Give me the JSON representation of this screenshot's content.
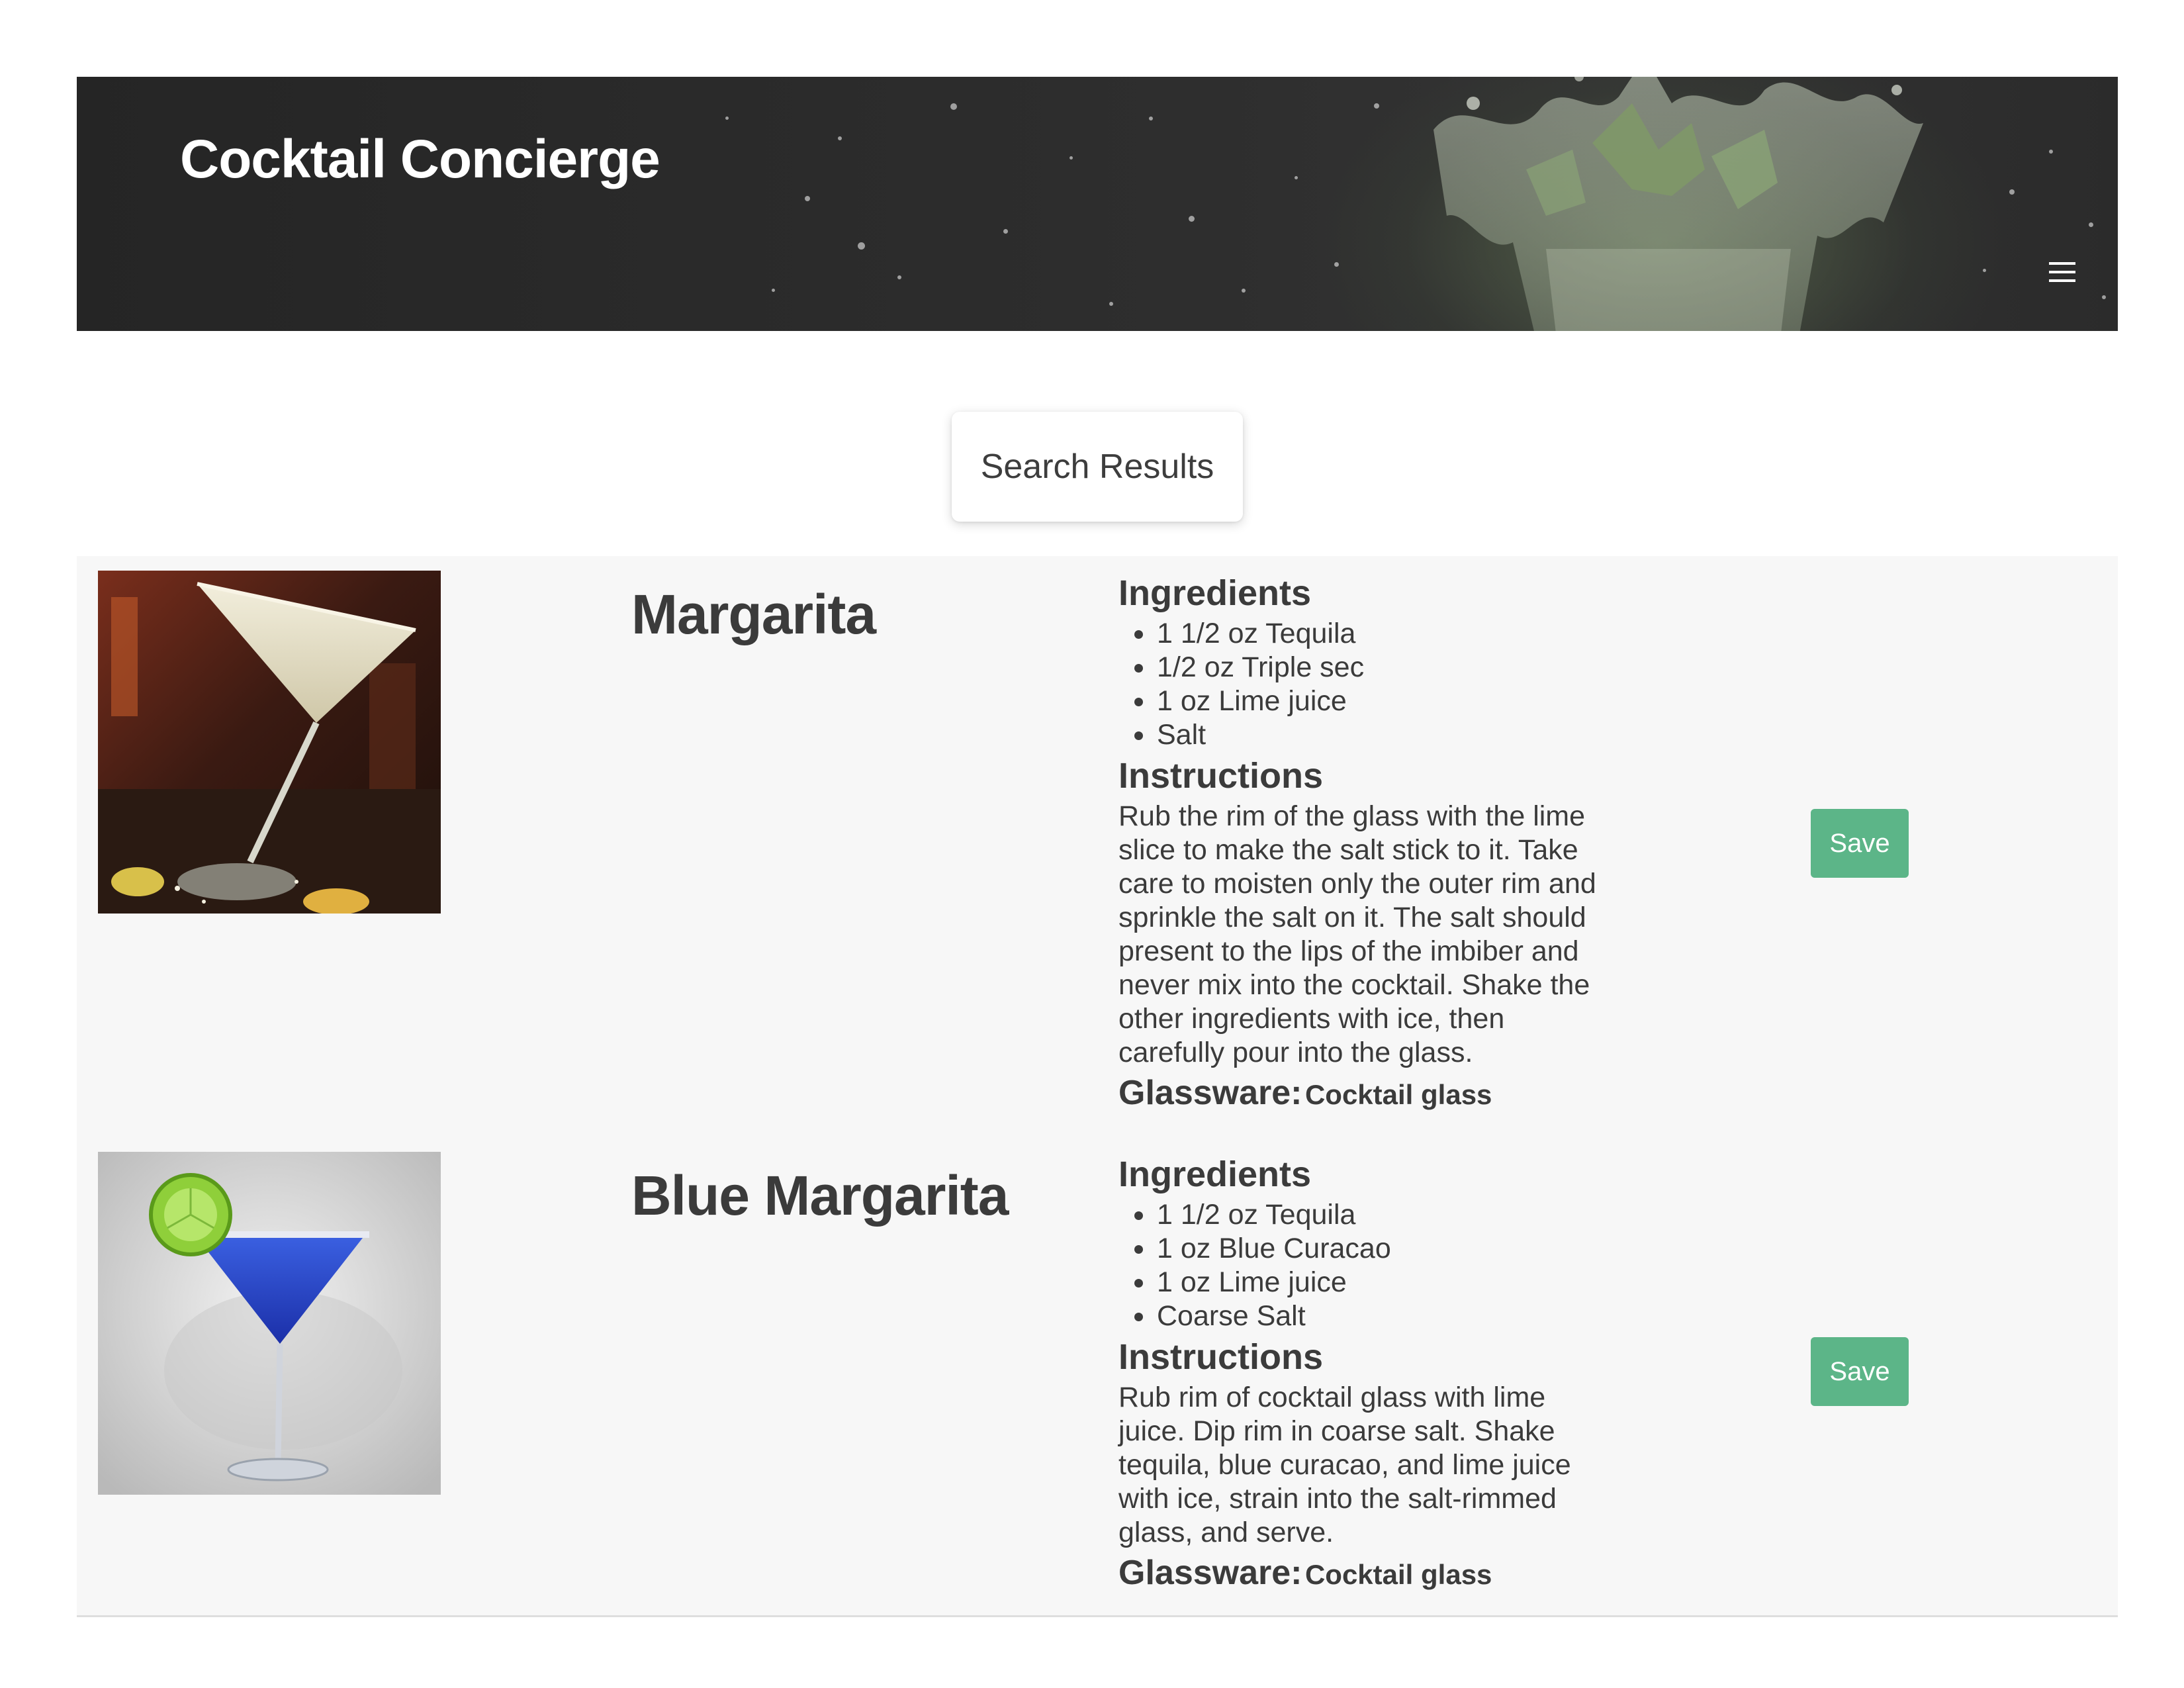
{
  "header": {
    "brand": "Cocktail Concierge",
    "menu_icon": "hamburger-menu-icon"
  },
  "results_heading": "Search Results",
  "drinks": [
    {
      "name": "Margarita",
      "image_icon": "margarita-photo",
      "ingredients_heading": "Ingredients",
      "ingredients": [
        "1 1/2 oz Tequila",
        "1/2 oz Triple sec",
        "1 oz Lime juice",
        "Salt"
      ],
      "instructions_heading": "Instructions",
      "instructions": "Rub the rim of the glass with the lime slice to make the salt stick to it. Take care to moisten only the outer rim and sprinkle the salt on it. The salt should present to the lips of the imbiber and never mix into the cocktail. Shake the other ingredients with ice, then carefully pour into the glass.",
      "glassware_label": "Glassware:",
      "glassware": "Cocktail glass",
      "save_label": "Save"
    },
    {
      "name": "Blue Margarita",
      "image_icon": "blue-margarita-photo",
      "ingredients_heading": "Ingredients",
      "ingredients": [
        "1 1/2 oz Tequila",
        "1 oz Blue Curacao",
        "1 oz Lime juice",
        "Coarse Salt"
      ],
      "instructions_heading": "Instructions",
      "instructions": "Rub rim of cocktail glass with lime juice. Dip rim in coarse salt. Shake tequila, blue curacao, and lime juice with ice, strain into the salt-rimmed glass, and serve.",
      "glassware_label": "Glassware:",
      "glassware": "Cocktail glass",
      "save_label": "Save"
    }
  ],
  "colors": {
    "header_bg": "#2b2b2b",
    "save_button": "#5cb588",
    "row_bg": "#f7f7f7",
    "text": "#3b3b3b"
  }
}
